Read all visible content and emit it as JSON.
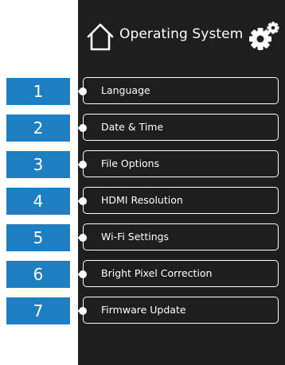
{
  "header": {
    "title": "Operating System",
    "home_icon": "home-icon",
    "settings_icon": "gears-icon"
  },
  "colors": {
    "panel_background": "#1e1e1e",
    "badge_blue": "#1e7fc0",
    "text": "#ffffff"
  },
  "menu": {
    "items": [
      {
        "number": "1",
        "label": "Language"
      },
      {
        "number": "2",
        "label": "Date & Time"
      },
      {
        "number": "3",
        "label": "File Options"
      },
      {
        "number": "4",
        "label": "HDMI Resolution"
      },
      {
        "number": "5",
        "label": "Wi-Fi Settings"
      },
      {
        "number": "6",
        "label": "Bright Pixel Correction"
      },
      {
        "number": "7",
        "label": "Firmware Update"
      }
    ]
  }
}
